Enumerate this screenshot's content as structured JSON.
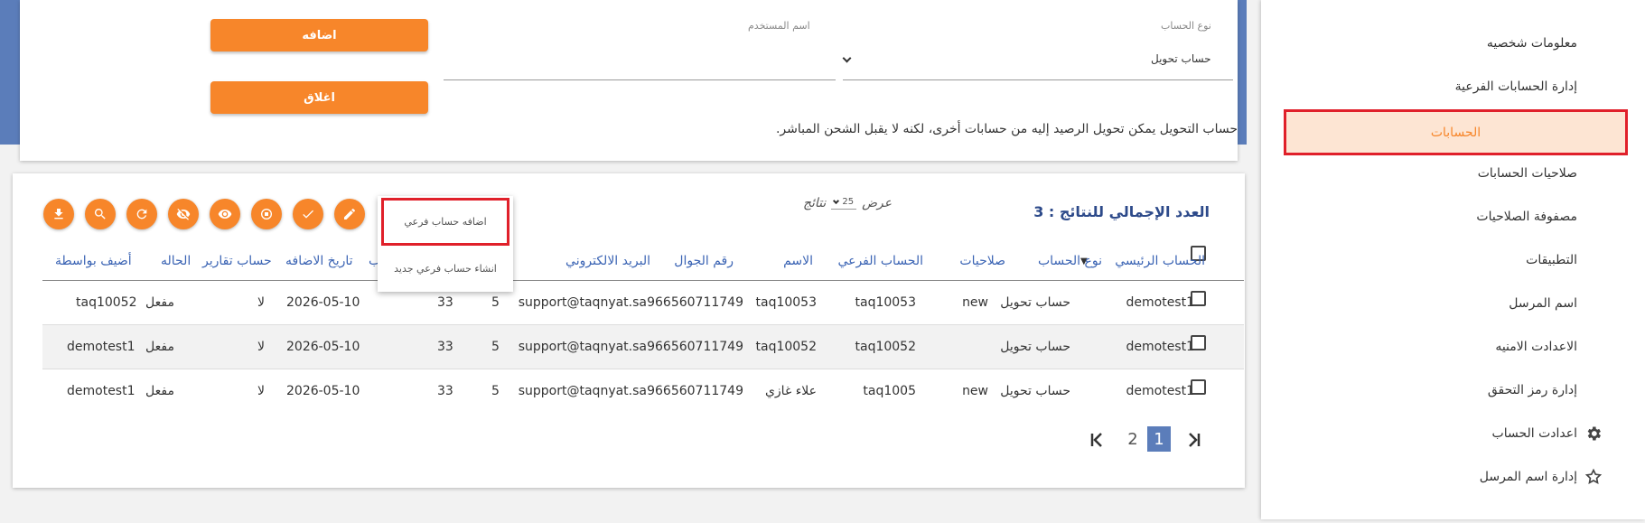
{
  "form": {
    "account_type_label": "نوع الحساب",
    "account_type_value": "حساب تحويل",
    "username_label": "اسم المستخدم",
    "add_button": "اضافه",
    "close_button": "اغلاق",
    "help_text": "حساب التحويل يمكن تحويل الرصيد إليه من حسابات أخرى، لكنه لا يقبل الشحن المباشر."
  },
  "table_header": {
    "total_results": "العدد الإجمالي للنتائج : 3",
    "show_label": "عرض",
    "per_page": "25",
    "results_label": "نتائج"
  },
  "toolbar_icons": [
    "edit-icon",
    "check-icon",
    "stop-icon",
    "eye-icon",
    "eye-off-icon",
    "refresh-icon",
    "search-icon",
    "download-icon"
  ],
  "dropdown": {
    "items": [
      "اضافه حساب فرعي",
      "انشاء حساب فرعي جديد"
    ]
  },
  "columns": [
    "الحساب الرئيسي",
    "نوع الحساب",
    "صلاحيات",
    "الحساب الفرعي",
    "الاسم",
    "رقم الجوال",
    "البريد الالكتروني",
    "",
    "",
    "ب",
    "تاريخ الاضافه",
    "حساب تقارير",
    "الحاله",
    "أضيف بواسطة"
  ],
  "rows": [
    [
      "demotest1",
      "حساب تحويل",
      "new",
      "taq10053",
      "taq10053",
      "966560711749",
      "support@taqnyat.sa",
      "5",
      "33",
      "2026-05-10",
      "لا",
      "مفعل",
      "taq10052"
    ],
    [
      "demotest1",
      "حساب تحويل",
      "",
      "taq10052",
      "taq10052",
      "966560711749",
      "support@taqnyat.sa",
      "5",
      "33",
      "2026-05-10",
      "لا",
      "مفعل",
      "demotest1"
    ],
    [
      "demotest1",
      "حساب تحويل",
      "new",
      "taq1005",
      "علاء غازي",
      "966560711749",
      "support@taqnyat.sa",
      "5",
      "33",
      "2026-05-10",
      "لا",
      "مفعل",
      "demotest1"
    ]
  ],
  "pagination": {
    "pages": [
      "1",
      "2"
    ],
    "active": "1"
  },
  "sidebar": {
    "items": [
      {
        "label": "معلومات شخصيه"
      },
      {
        "label": "إدارة الحسابات الفرعية"
      },
      {
        "label": "الحسابات"
      },
      {
        "label": "صلاحيات الحسابات"
      },
      {
        "label": "مصفوفة الصلاحيات"
      },
      {
        "label": "التطبيقات"
      },
      {
        "label": "اسم المرسل"
      },
      {
        "label": "الاعدادت الامنيه"
      },
      {
        "label": "إدارة رمز التحقق"
      },
      {
        "label": "اعدادت الحساب",
        "icon": "gear-icon"
      },
      {
        "label": "إدارة اسم المرسل",
        "icon": "star-icon"
      }
    ],
    "active": "الحسابات"
  },
  "colors": {
    "accent": "#f7862a",
    "banner": "#5b7dba",
    "highlight_border": "#e0202a",
    "active_bg": "#fde5d3",
    "header_text": "#3b64b4"
  }
}
